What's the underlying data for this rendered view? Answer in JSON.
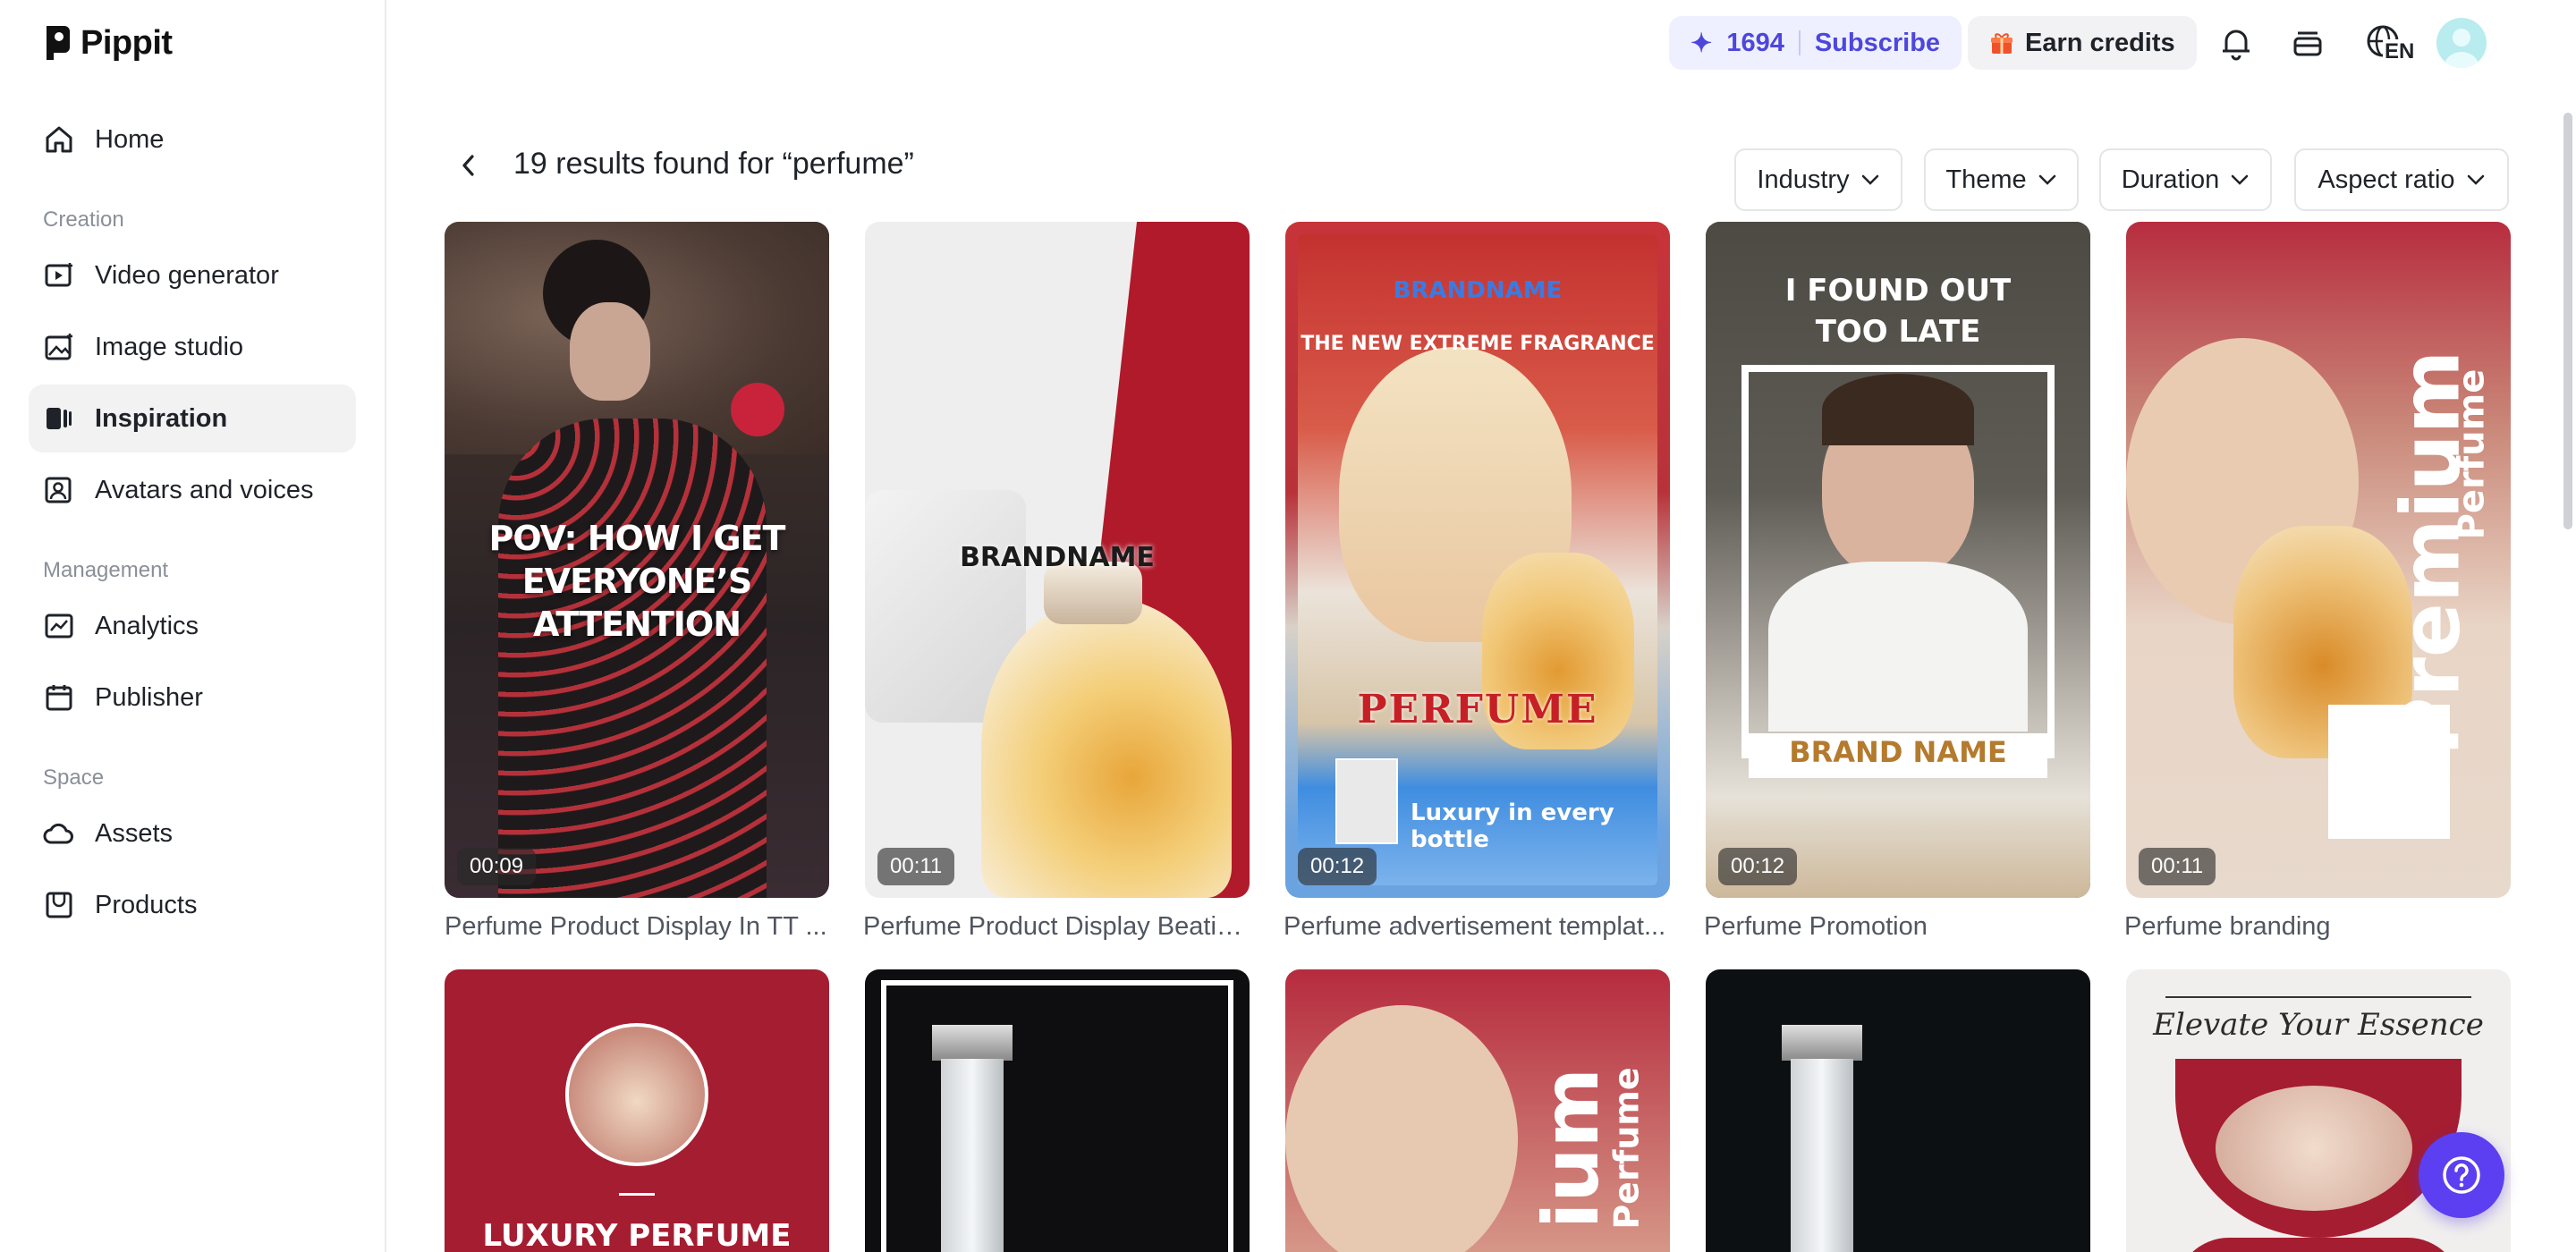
{
  "app": {
    "name": "Pippit"
  },
  "sidebar": {
    "items_top": [
      {
        "label": "Home",
        "icon": "home-icon"
      }
    ],
    "sections": [
      {
        "label": "Creation",
        "items": [
          {
            "label": "Video generator",
            "icon": "video-generator-icon"
          },
          {
            "label": "Image studio",
            "icon": "image-studio-icon"
          },
          {
            "label": "Inspiration",
            "icon": "inspiration-icon",
            "active": true
          },
          {
            "label": "Avatars and voices",
            "icon": "avatar-voice-icon"
          }
        ]
      },
      {
        "label": "Management",
        "items": [
          {
            "label": "Analytics",
            "icon": "analytics-icon"
          },
          {
            "label": "Publisher",
            "icon": "calendar-icon"
          }
        ]
      },
      {
        "label": "Space",
        "items": [
          {
            "label": "Assets",
            "icon": "cloud-icon"
          },
          {
            "label": "Products",
            "icon": "product-box-icon"
          }
        ]
      }
    ]
  },
  "topbar": {
    "credits": "1694",
    "subscribe_label": "Subscribe",
    "earn_label": "Earn credits",
    "language": "EN",
    "accent_color": "#4e46dc"
  },
  "search": {
    "results_title": "19 results found for “perfume”",
    "filters": [
      "Industry",
      "Theme",
      "Duration",
      "Aspect ratio"
    ]
  },
  "cards": [
    {
      "title": "Perfume Product Display In TT ...",
      "duration": "00:09",
      "overlay": "POV: HOW I GET EVERYONE’S ATTENTION"
    },
    {
      "title": "Perfume Product Display Beatin...",
      "duration": "00:11",
      "overlay": "BRANDNAME"
    },
    {
      "title": "Perfume advertisement templat...",
      "duration": "00:12",
      "overlay_top": "BRANDNAME",
      "overlay_sub": "THE NEW EXTREME FRAGRANCE",
      "overlay_main": "PERFUME",
      "overlay_bottom": "Luxury in every bottle"
    },
    {
      "title": "Perfume Promotion",
      "duration": "00:12",
      "overlay_top": "I FOUND OUT TOO LATE",
      "overlay_bottom": "BRAND NAME"
    },
    {
      "title": "Perfume branding",
      "duration": "00:11",
      "overlay_main": "Premium",
      "overlay_sub": "Perfume"
    }
  ],
  "cards_row2": [
    {
      "overlay": "LUXURY PERFUME"
    },
    {
      "overlay": ""
    },
    {
      "overlay_main": "ium",
      "overlay_sub": "Perfume"
    },
    {
      "overlay": ""
    },
    {
      "overlay": "Elevate Your Essence"
    }
  ]
}
